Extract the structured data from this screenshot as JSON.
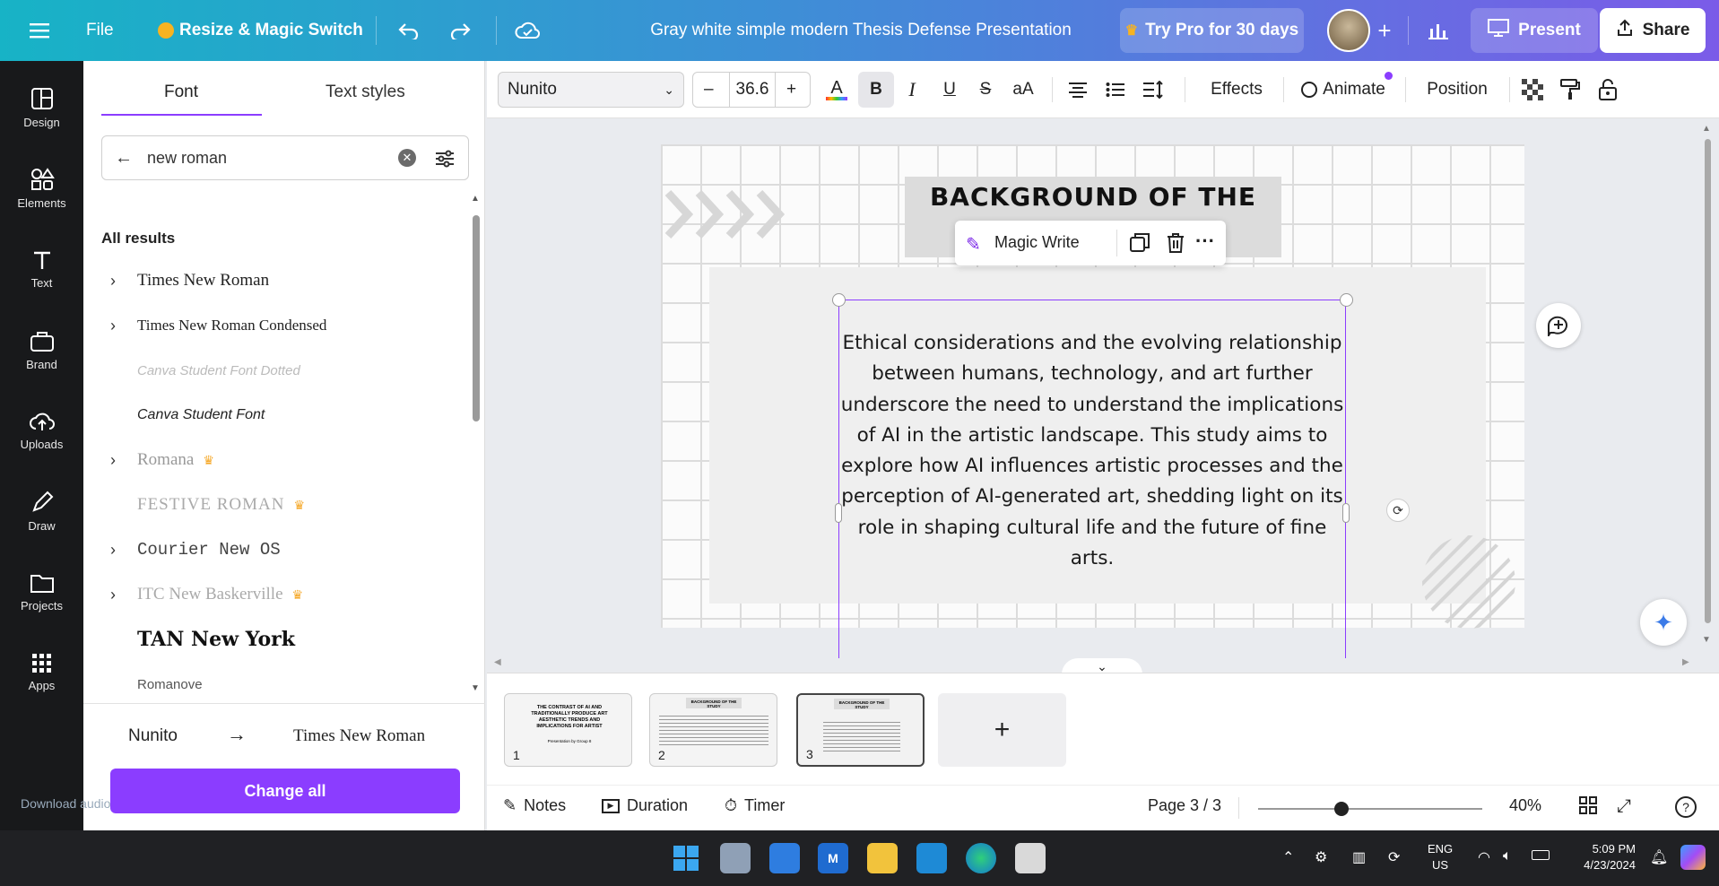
{
  "topbar": {
    "file": "File",
    "resize": "Resize & Magic Switch",
    "doc_title": "Gray white simple modern Thesis Defense Presentation",
    "try_pro": "Try Pro for 30 days",
    "present": "Present",
    "share": "Share"
  },
  "rail": [
    {
      "label": "Design",
      "icon": "design-icon"
    },
    {
      "label": "Elements",
      "icon": "elements-icon"
    },
    {
      "label": "Text",
      "icon": "text-icon"
    },
    {
      "label": "Brand",
      "icon": "brand-icon"
    },
    {
      "label": "Uploads",
      "icon": "upload-icon"
    },
    {
      "label": "Draw",
      "icon": "draw-icon"
    },
    {
      "label": "Projects",
      "icon": "folder-icon"
    },
    {
      "label": "Apps",
      "icon": "apps-icon"
    }
  ],
  "panel": {
    "tab_font": "Font",
    "tab_styles": "Text styles",
    "search_value": "new roman",
    "all_results": "All results",
    "fonts": [
      {
        "name": "Times New Roman",
        "expand": true,
        "pro": false
      },
      {
        "name": "Times New Roman Condensed",
        "expand": true,
        "pro": false
      },
      {
        "name": "Canva Student Font Dotted",
        "expand": false,
        "pro": false
      },
      {
        "name": "Canva Student Font",
        "expand": false,
        "pro": false
      },
      {
        "name": "Romana",
        "expand": true,
        "pro": true
      },
      {
        "name": "FESTIVE ROMAN",
        "expand": false,
        "pro": true
      },
      {
        "name": "Courier New OS",
        "expand": true,
        "pro": false
      },
      {
        "name": "ITC New Baskerville",
        "expand": true,
        "pro": true
      },
      {
        "name": "TAN New York",
        "expand": false,
        "pro": false
      },
      {
        "name": "Romanove",
        "expand": false,
        "pro": false
      }
    ],
    "replace_from": "Nunito",
    "replace_to": "Times New Roman",
    "change_all": "Change all",
    "ghost_text": "Download audio from this page"
  },
  "toolbar": {
    "font": "Nunito",
    "size": "36.6",
    "minus": "–",
    "plus": "+",
    "bold": "B",
    "italic": "I",
    "underline": "U",
    "strike": "S",
    "case": "aA",
    "effects": "Effects",
    "animate": "Animate",
    "position": "Position"
  },
  "slide": {
    "heading": "BACKGROUND OF THE",
    "magic_write": "Magic Write",
    "body": "Ethical considerations and the evolving relationship between humans, technology, and art further underscore the need to understand the implications of AI in the artistic landscape. This study aims to explore how AI influences artistic processes and the perception of AI-generated art, shedding light on its role in shaping cultural life and the future of fine arts."
  },
  "pages": {
    "thumbs": [
      {
        "n": "1",
        "title": "THE CONTRAST OF AI AND TRADITIONALLY PRODUCE ART AESTHETIC TRENDS AND IMPLICATIONS FOR ARTIST",
        "sub": "Presentation by Group 8"
      },
      {
        "n": "2",
        "title": "BACKGROUND OF THE STUDY",
        "sub": ""
      },
      {
        "n": "3",
        "title": "BACKGROUND OF THE STUDY",
        "sub": ""
      }
    ]
  },
  "footer": {
    "notes": "Notes",
    "duration": "Duration",
    "timer": "Timer",
    "page": "Page 3 / 3",
    "zoom": "40%",
    "zoom_level": 0.4
  },
  "taskbar": {
    "lang1": "ENG",
    "lang2": "US",
    "time": "5:09 PM",
    "date": "4/23/2024"
  },
  "colors": {
    "accent": "#8b3dff",
    "brand_purple": "#7d2ae8"
  }
}
